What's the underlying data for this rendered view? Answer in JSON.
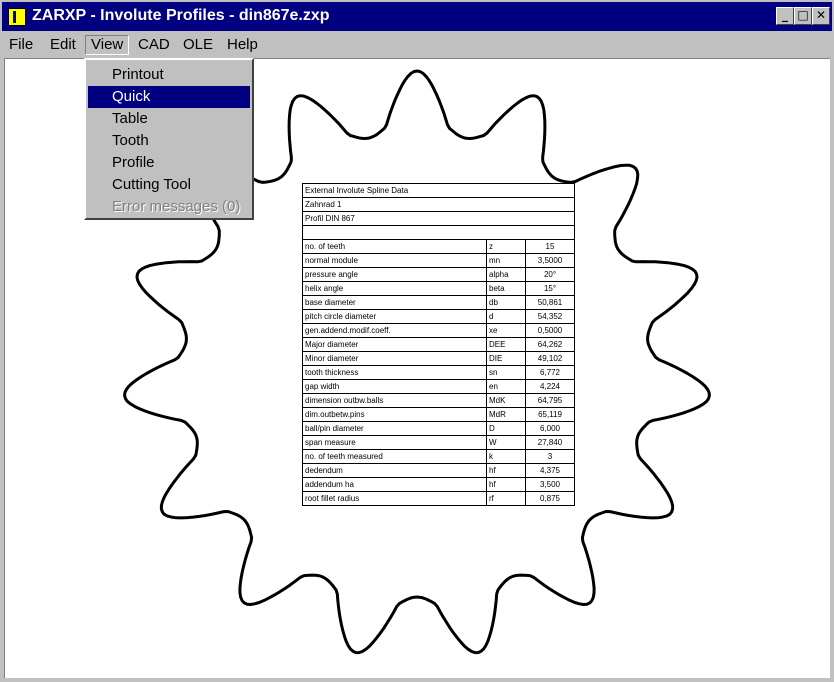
{
  "window": {
    "title": "ZARXP - Involute Profiles  -  din867e.zxp",
    "minimize_glyph": "_",
    "maximize_glyph": "□",
    "close_glyph": "✕"
  },
  "menubar": {
    "items": [
      "File",
      "Edit",
      "View",
      "CAD",
      "OLE",
      "Help"
    ]
  },
  "view_menu": {
    "items": [
      {
        "label": "Printout",
        "state": "normal"
      },
      {
        "label": "Quick",
        "state": "selected"
      },
      {
        "label": "Table",
        "state": "normal"
      },
      {
        "label": "Tooth",
        "state": "normal"
      },
      {
        "label": "Profile",
        "state": "normal"
      },
      {
        "label": "Cutting Tool",
        "state": "normal"
      },
      {
        "label": "Error messages (0)",
        "state": "disabled"
      }
    ]
  },
  "spline_table": {
    "header_lines": [
      "External Involute Spline Data",
      "Zahnrad 1",
      "Profil DIN 867",
      ""
    ],
    "rows": [
      [
        "no. of teeth",
        "z",
        "15"
      ],
      [
        "normal module",
        "mn",
        "3,5000"
      ],
      [
        "pressure angle",
        "alpha",
        "20°"
      ],
      [
        "helix angle",
        "beta",
        "15°"
      ],
      [
        "base diameter",
        "db",
        "50,861"
      ],
      [
        "pitch circle diameter",
        "d",
        "54,352"
      ],
      [
        "gen.addend.modif.coeff.",
        "xe",
        "0,5000"
      ],
      [
        "Major diameter",
        "DEE",
        "64,262"
      ],
      [
        "Minor diameter",
        "DIE",
        "49,102"
      ],
      [
        "tooth thickness",
        "sn",
        "6,772"
      ],
      [
        "gap width",
        "en",
        "4,224"
      ],
      [
        "dimension outbw.balls",
        "MdK",
        "64,795"
      ],
      [
        "dim.outbetw.pins",
        "MdR",
        "65,119"
      ],
      [
        "ball/pin diameter",
        "D",
        "6,000"
      ],
      [
        "span measure",
        "W",
        "27,840"
      ],
      [
        "no. of teeth measured",
        "k",
        "3"
      ],
      [
        "dedendum",
        "hf",
        "4,375"
      ],
      [
        "addendum ha",
        "hf",
        "3,500"
      ],
      [
        "root fillet radius",
        "rf",
        "0,875"
      ]
    ]
  },
  "gear": {
    "teeth": 15,
    "outline_color": "#000000"
  },
  "colors": {
    "titlebar": "#000080",
    "face": "#c0c0c0",
    "highlight": "#000080"
  }
}
